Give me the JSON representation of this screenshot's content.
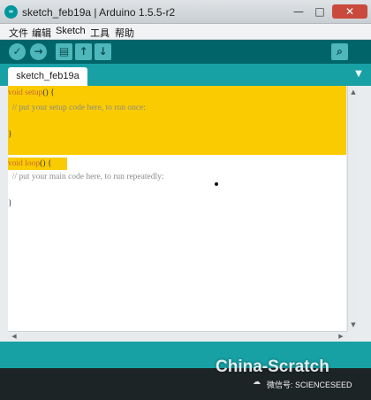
{
  "window": {
    "app_icon": "arduino-logo-icon",
    "app_icon_text": "∞",
    "title": "sketch_feb19a | Arduino 1.5.5-r2",
    "minimize": "—",
    "maximize": "□",
    "close": "✕"
  },
  "menu": {
    "items": [
      {
        "label": "文件"
      },
      {
        "label": "编辑"
      },
      {
        "label": "Sketch"
      },
      {
        "label": "工具"
      },
      {
        "label": "帮助"
      }
    ]
  },
  "toolbar": {
    "verify_icon": "✓",
    "upload_icon": "→",
    "new_icon": "▤",
    "open_icon": "↑",
    "save_icon": "↓",
    "serial_icon": "⌕"
  },
  "tabs": {
    "active": "sketch_feb19a",
    "menu_icon": "▼"
  },
  "editor": {
    "lines": {
      "setup_sig_kw": "void setup",
      "setup_sig_rest": "() {",
      "setup_comment": "  // put your setup code here, to run once:",
      "setup_close": "}",
      "loop_sig_kw": "void loop",
      "loop_sig_rest": "() {",
      "loop_comment": "  // put your main code here, to run repeatedly:",
      "loop_close": "}"
    },
    "highlight_color": "#f9cb00"
  },
  "scroll": {
    "up": "▲",
    "down": "▼",
    "left": "◀",
    "right": "▶"
  },
  "watermark": {
    "main": "China-Scratch",
    "sub": "微信号: SCIENCESEED",
    "icon": "wechat-icon",
    "icon_glyph": "☁"
  },
  "colors": {
    "toolbar": "#006468",
    "tabstrip": "#17a1a5",
    "button": "#4db7bb",
    "console": "#1d2426"
  }
}
